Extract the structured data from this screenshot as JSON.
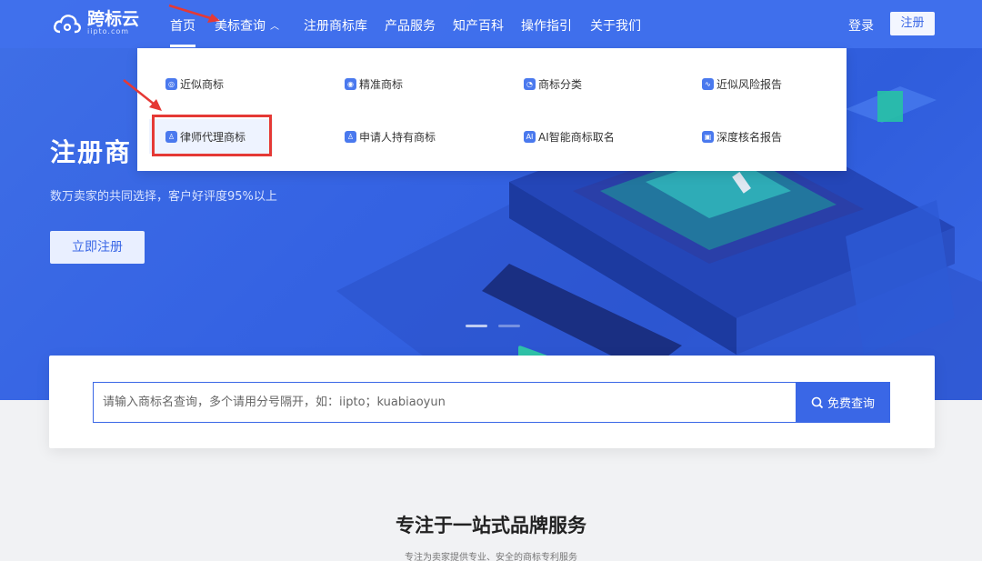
{
  "logo": {
    "name": "跨标云",
    "domain": "iipto.com"
  },
  "nav": {
    "items": [
      {
        "label": "首页"
      },
      {
        "label": "美标查询"
      },
      {
        "label": "注册商标库"
      },
      {
        "label": "产品服务"
      },
      {
        "label": "知产百科"
      },
      {
        "label": "操作指引"
      },
      {
        "label": "关于我们"
      }
    ],
    "login": "登录",
    "register": "注册"
  },
  "dropdown": {
    "items": [
      {
        "label": "近似商标",
        "icon": "magnify-icon"
      },
      {
        "label": "精准商标",
        "icon": "target-icon"
      },
      {
        "label": "商标分类",
        "icon": "pie-icon"
      },
      {
        "label": "近似风险报告",
        "icon": "chart-icon"
      },
      {
        "label": "律师代理商标",
        "icon": "person-icon"
      },
      {
        "label": "申请人持有商标",
        "icon": "user-icon"
      },
      {
        "label": "AI智能商标取名",
        "icon": "ai-icon"
      },
      {
        "label": "深度核名报告",
        "icon": "scan-icon"
      }
    ]
  },
  "hero": {
    "title": "注册商",
    "subtitle": "数万卖家的共同选择，客户好评度95%以上",
    "cta": "立即注册"
  },
  "search": {
    "placeholder": "请输入商标名查询，多个请用分号隔开，如：iipto；kuabiaoyun",
    "button": "免费查询"
  },
  "section": {
    "title": "专注于一站式品牌服务",
    "subtitle": "专注为卖家提供专业、安全的商标专利服务"
  },
  "colors": {
    "brand": "#3a67e6",
    "annotation": "#e53935"
  }
}
